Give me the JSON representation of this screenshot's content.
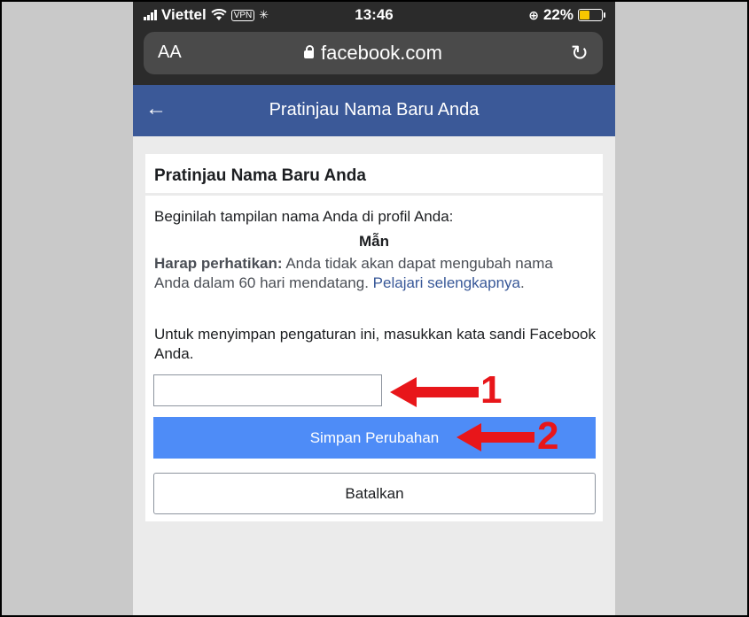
{
  "statusbar": {
    "carrier": "Viettel",
    "vpn": "VPN",
    "time": "13:46",
    "battery": "22%"
  },
  "browser": {
    "text_size": "AA",
    "url": "facebook.com"
  },
  "header": {
    "title": "Pratinjau Nama Baru Anda"
  },
  "card": {
    "title": "Pratinjau Nama Baru Anda",
    "intro": "Beginilah tampilan nama Anda di profil Anda:",
    "new_name": "Mẫn",
    "note_label": "Harap perhatikan:",
    "note_text": " Anda tidak akan dapat mengubah nama Anda dalam 60 hari mendatang. ",
    "learn_more": "Pelajari selengkapnya",
    "note_end": ".",
    "password_prompt": "Untuk menyimpan pengaturan ini, masukkan kata sandi Facebook Anda.",
    "password_value": "",
    "save_label": "Simpan Perubahan",
    "cancel_label": "Batalkan"
  },
  "annotations": {
    "step1": "1",
    "step2": "2",
    "color": "#e8161a"
  },
  "colors": {
    "fb_header": "#3b5998",
    "save_button": "#4e8cf7",
    "link": "#385898"
  }
}
